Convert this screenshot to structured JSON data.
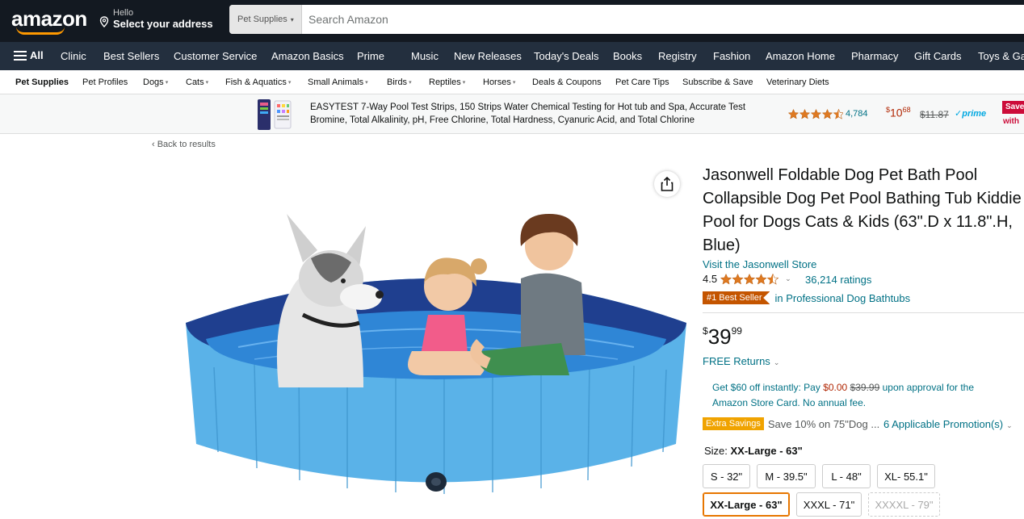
{
  "header": {
    "logo_text": "amazon",
    "deliver_hello": "Hello",
    "deliver_address": "Select your address",
    "search_category": "Pet Supplies",
    "search_placeholder": "Search Amazon"
  },
  "nav": {
    "all_label": "All",
    "items": [
      "Clinic",
      "Best Sellers",
      "Customer Service",
      "Amazon Basics",
      "Prime",
      "Music",
      "New Releases",
      "Today's Deals",
      "Books",
      "Registry",
      "Fashion",
      "Amazon Home",
      "Pharmacy",
      "Gift Cards",
      "Toys & Ga"
    ]
  },
  "subnav": {
    "items": [
      "Pet Supplies",
      "Pet Profiles",
      "Dogs",
      "Cats",
      "Fish & Aquatics",
      "Small Animals",
      "Birds",
      "Reptiles",
      "Horses",
      "Deals & Coupons",
      "Pet Care Tips",
      "Subscribe & Save",
      "Veterinary Diets"
    ]
  },
  "banner": {
    "title": "EASYTEST 7-Way Pool Test Strips, 150 Strips Water Chemical Testing for Hot tub and Spa, Accurate Test Bromine, Total Alkalinity, pH, Free Chlorine, Total Hardness, Cyanuric Acid, and Total Chlorine",
    "rating_count": "4,784",
    "price_symbol": "$",
    "price_whole": "10",
    "price_fraction": "68",
    "list_price": "$11.87",
    "prime_label": "prime",
    "save_label": "Save",
    "save_with": "with"
  },
  "back_link": "‹ Back to results",
  "product": {
    "title": "Jasonwell Foldable Dog Pet Bath Pool Collapsible Dog Pet Pool Bathing Tub Kiddie Pool for Dogs Cats & Kids (63\".D x 11.8\".H, Blue)",
    "store": "Visit the Jasonwell Store",
    "rating": "4.5",
    "rating_count": "36,214 ratings",
    "best_seller_badge": "#1 Best Seller",
    "best_seller_category": "in Professional Dog Bathtubs",
    "price_symbol": "$",
    "price_whole": "39",
    "price_fraction": "99",
    "returns": "FREE Returns",
    "card_offer_1": "Get $60 off instantly: Pay ",
    "card_pay": "$0.00",
    "card_strike": "$39.99",
    "card_offer_2": " upon approval for the Amazon Store Card. No annual fee.",
    "extra_savings_label": "Extra Savings",
    "extra_savings_text": "Save 10% on 75\"Dog ...",
    "promotions": "6 Applicable Promotion(s)",
    "size_label": "Size: ",
    "size_selected": "XX-Large - 63\"",
    "sizes": [
      "S - 32\"",
      "M - 39.5\"",
      "L - 48\"",
      "XL- 55.1\"",
      "XX-Large - 63\"",
      "XXXL - 71\"",
      "XXXXL - 79\""
    ]
  },
  "colors": {
    "nav_dark": "#131921",
    "nav_secondary": "#232f3e",
    "link": "#007185",
    "price_red": "#b12704",
    "best_seller": "#c45500",
    "accent_orange": "#ff9900"
  }
}
